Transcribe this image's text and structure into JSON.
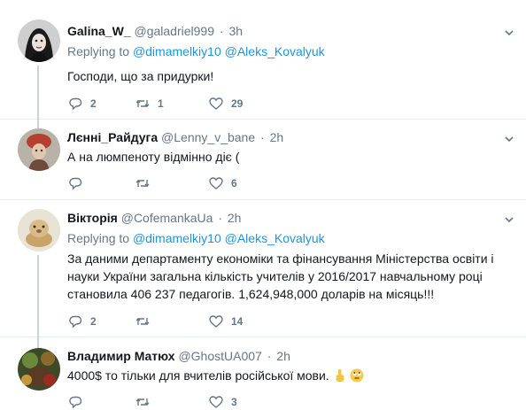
{
  "tweets": [
    {
      "name": "Galina_W_",
      "handle": "@galadriel999",
      "time": "3h",
      "replying_label": "Replying to",
      "replying_to": "@dimamelkiy10 @Aleks_Kovalyuk",
      "text": "Господи, що за придурки!",
      "replies": "2",
      "retweets": "1",
      "likes": "29"
    },
    {
      "name": "Лєнні_Райдуга",
      "handle": "@Lenny_v_bane",
      "time": "2h",
      "text": "А на люмпеноту відмінно діє (",
      "replies": "",
      "retweets": "",
      "likes": "6"
    },
    {
      "name": "Вікторія",
      "handle": "@CofemankaUa",
      "time": "2h",
      "replying_label": "Replying to",
      "replying_to": "@dimamelkiy10 @Aleks_Kovalyuk",
      "text": "За даними департаменту економіки та фінансування Міністерства освіти і науки України загальна кількість учителів у 2016/2017 навчальному році становила 406 237 педагогів. 1,624,948,000 доларів на місяць!!!",
      "replies": "2",
      "retweets": "",
      "likes": "14"
    },
    {
      "name": "Владимир Матюх",
      "handle": "@GhostUA007",
      "time": "2h",
      "text": "4000$ то тільки для вчителів російської мови.",
      "replies": "",
      "retweets": "",
      "likes": "3"
    }
  ],
  "colors": {
    "text": "#14171a",
    "secondary": "#657786",
    "link": "#1b95e0",
    "divider": "#e6ecf0",
    "thread_line": "#cbd3da"
  },
  "icons": [
    "reply-icon",
    "retweet-icon",
    "heart-icon",
    "chevron-down-icon",
    "finger-up-emoji",
    "face-rolling-eyes-emoji"
  ]
}
